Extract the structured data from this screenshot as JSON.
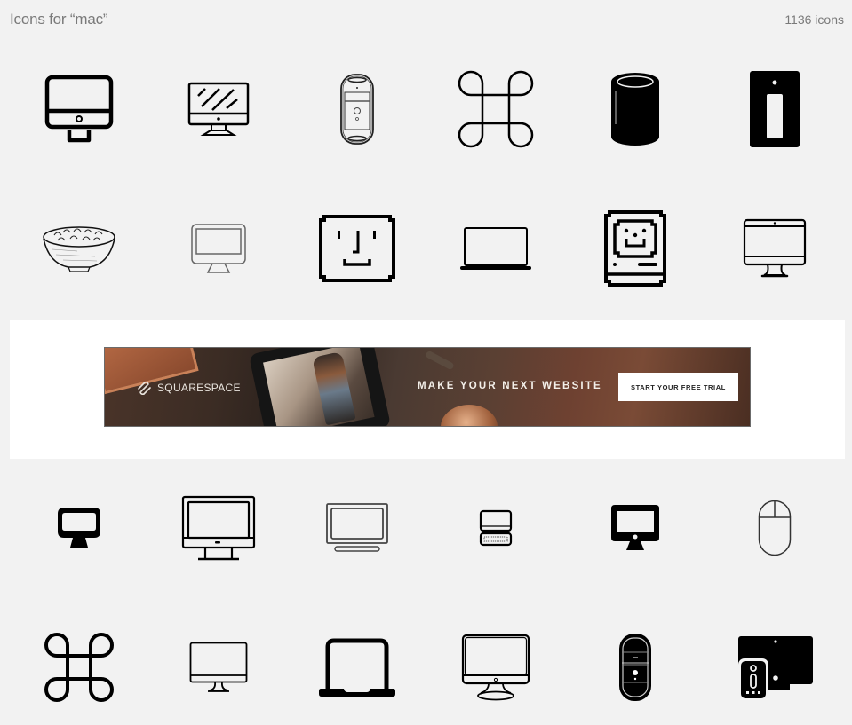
{
  "header": {
    "title": "Icons for “mac”",
    "count": "1136 icons"
  },
  "icon_rows": [
    [
      "imac-bold-icon",
      "imac-glare-icon",
      "power-mac-g4-cube-tower-icon",
      "command-key-icon",
      "mac-pro-cylinder-icon",
      "mac-mini-tower-icon"
    ],
    [
      "macaroni-bowl-icon",
      "monitor-outline-icon",
      "mac-finder-face-icon",
      "macbook-laptop-icon",
      "classic-macintosh-icon",
      "imac-thin-icon"
    ],
    [
      "imac-rounded-filled-icon",
      "imac-large-icon",
      "display-stand-icon",
      "computer-keyboard-icon",
      "imac-filled-icon",
      "mouse-icon"
    ],
    [
      "command-key-bold-icon",
      "imac-slim-icon",
      "macbook-bold-icon",
      "imac-classic-stand-icon",
      "power-mac-g5-icon",
      "imac-with-tower-icon"
    ]
  ],
  "ad": {
    "brand": "SQUARESPACE",
    "headline": "MAKE YOUR NEXT WEBSITE",
    "cta": "START YOUR FREE TRIAL"
  }
}
